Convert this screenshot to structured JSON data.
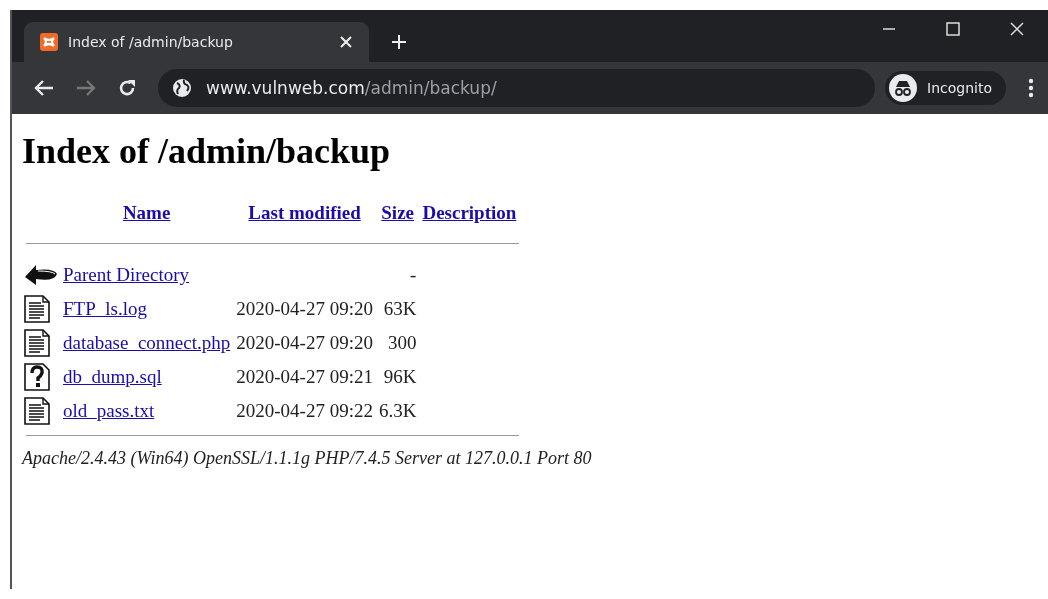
{
  "window": {
    "tabs": [
      {
        "title": "Index of /admin/backup",
        "selected": true
      }
    ],
    "address": {
      "host": "www.vulnweb.com",
      "path": "/admin/backup/"
    },
    "profile": "Incognito"
  },
  "page": {
    "heading": "Index of /admin/backup",
    "columns": [
      "Name",
      "Last modified",
      "Size",
      "Description"
    ],
    "rows": [
      {
        "kind": "back",
        "name": "Parent Directory",
        "size": "-"
      },
      {
        "kind": "text",
        "name": "FTP_ls.log",
        "modified": "2020-04-27 09:20",
        "size": "63K"
      },
      {
        "kind": "text",
        "name": "database_connect.php",
        "modified": "2020-04-27 09:20",
        "size": "300"
      },
      {
        "kind": "unknown",
        "name": "db_dump.sql",
        "modified": "2020-04-27 09:21",
        "size": "96K"
      },
      {
        "kind": "text",
        "name": "old_pass.txt",
        "modified": "2020-04-27 09:22",
        "size": "6.3K"
      }
    ],
    "footer": "Apache/2.4.43 (Win64) OpenSSL/1.1.1g PHP/7.4.5 Server at 127.0.0.1 Port 80"
  }
}
